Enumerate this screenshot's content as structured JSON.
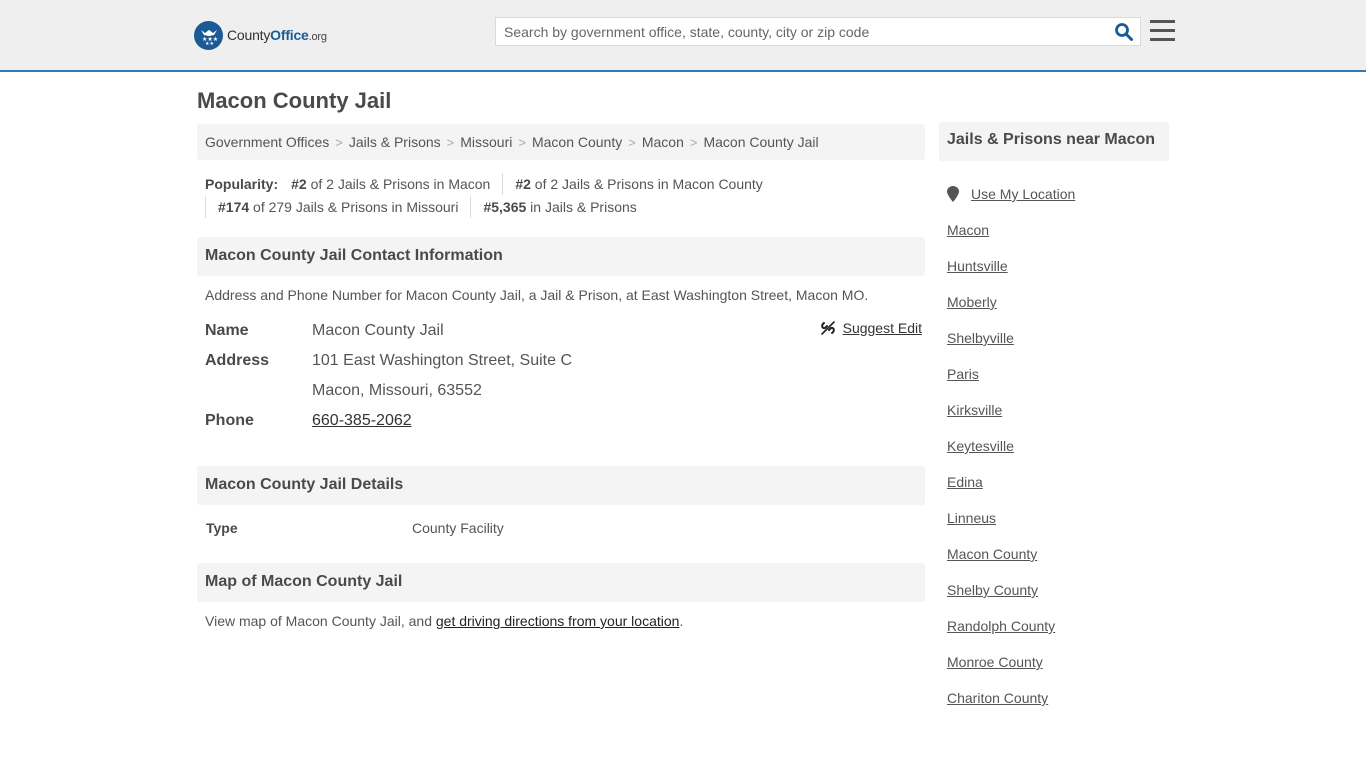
{
  "header": {
    "logo": {
      "prefix": "County",
      "brand": "Office",
      "tld": ".org"
    },
    "search": {
      "placeholder": "Search by government office, state, county, city or zip code",
      "value": "",
      "icon": "search-icon"
    },
    "menu_icon": "hamburger-menu-icon",
    "accent_color": "#2f7bb5",
    "brand_color": "#1a5a96"
  },
  "page": {
    "title": "Macon County Jail"
  },
  "breadcrumb": [
    {
      "label": "Government Offices"
    },
    {
      "label": "Jails & Prisons"
    },
    {
      "label": "Missouri"
    },
    {
      "label": "Macon County"
    },
    {
      "label": "Macon"
    },
    {
      "label": "Macon County Jail"
    }
  ],
  "popularity": {
    "label": "Popularity:",
    "items": [
      {
        "rank": "#2",
        "text": " of 2 Jails & Prisons in Macon"
      },
      {
        "rank": "#2",
        "text": " of 2 Jails & Prisons in Macon County"
      },
      {
        "rank": "#174",
        "text": " of 279 Jails & Prisons in Missouri"
      },
      {
        "rank": "#5,365",
        "text": " in Jails & Prisons"
      }
    ]
  },
  "contact": {
    "heading": "Macon County Jail Contact Information",
    "description": "Address and Phone Number for Macon County Jail, a Jail & Prison, at East Washington Street, Macon MO.",
    "suggest_edit": "Suggest Edit",
    "name_label": "Name",
    "name_value": "Macon County Jail",
    "address_label": "Address",
    "address_line1": "101 East Washington Street, Suite C",
    "address_line2": "Macon, Missouri, 63552",
    "phone_label": "Phone",
    "phone_value": "660-385-2062"
  },
  "details": {
    "heading": "Macon County Jail Details",
    "type_label": "Type",
    "type_value": "County Facility"
  },
  "map": {
    "heading": "Map of Macon County Jail",
    "text_before": "View map of Macon County Jail, and ",
    "link_text": "get driving directions from your location",
    "text_after": "."
  },
  "sidebar": {
    "heading": "Jails & Prisons near Macon",
    "use_location": "Use My Location",
    "links": [
      "Macon",
      "Huntsville",
      "Moberly",
      "Shelbyville",
      "Paris",
      "Kirksville",
      "Keytesville",
      "Edina",
      "Linneus",
      "Macon County",
      "Shelby County",
      "Randolph County",
      "Monroe County",
      "Chariton County"
    ]
  }
}
